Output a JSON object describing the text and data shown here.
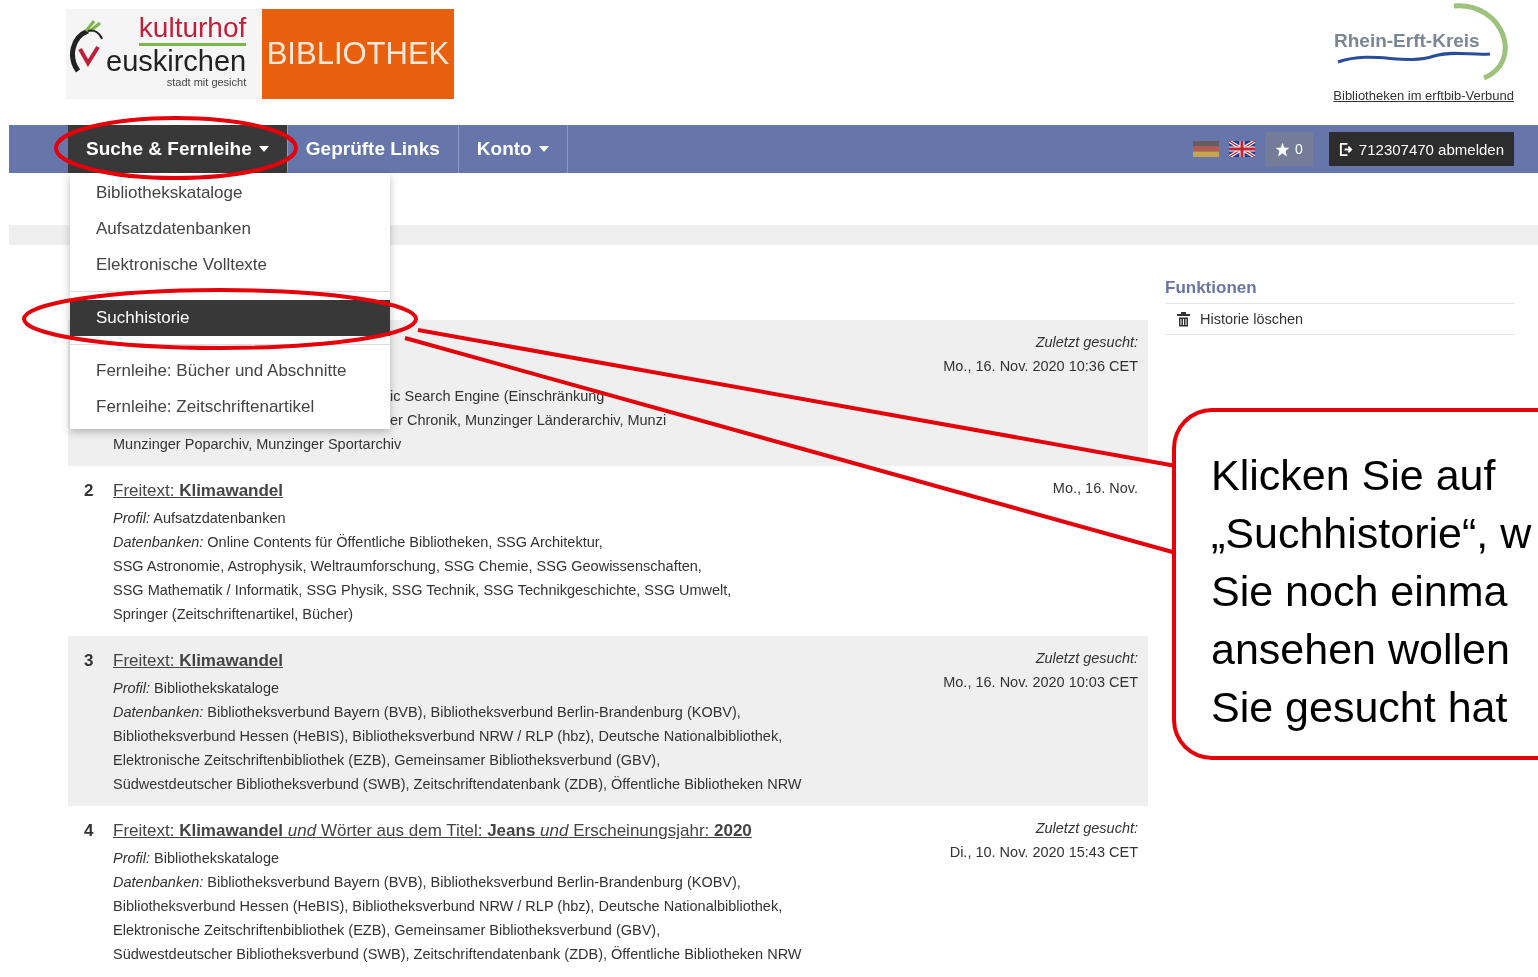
{
  "header": {
    "logo": {
      "line_1": "kulturhof",
      "line_2": "euskirchen",
      "tagline": "stadt mit gesicht",
      "badge": "BIBLIOTHEK"
    },
    "partner": {
      "name": "Rhein-Erft-Kreis",
      "link": "Bibliotheken im erftbib-Verbund"
    }
  },
  "nav": {
    "tabs": [
      {
        "label": "Suche & Fernleihe",
        "dropdown": true,
        "selected": true
      },
      {
        "label": "Geprüfte Links",
        "dropdown": false,
        "selected": false
      },
      {
        "label": "Konto",
        "dropdown": true,
        "selected": false
      }
    ],
    "favorites": {
      "count": "0"
    },
    "logout": {
      "label": "712307470 abmelden"
    }
  },
  "dropdown": {
    "groups": [
      [
        {
          "label": "Bibliothekskataloge",
          "selected": false
        },
        {
          "label": "Aufsatzdatenbanken",
          "selected": false
        },
        {
          "label": "Elektronische Volltexte",
          "selected": false
        }
      ],
      [
        {
          "label": "Suchhistorie",
          "selected": true
        }
      ],
      [
        {
          "label": "Fernleihe: Bücher und Abschnitte",
          "selected": false
        },
        {
          "label": "Fernleihe: Zeitschriftenartikel",
          "selected": false
        }
      ]
    ]
  },
  "history": [
    {
      "kind": "partial",
      "last_label": "Zuletzt gesucht:",
      "date": "Mo., 16. Nov. 2020 10:36 CET",
      "lines": [
        {
          "text": "ic Search Engine (Einschränkung",
          "covered": true
        },
        {
          "text": "er Chronik, Munzinger Länderarchiv, Munzi",
          "covered": true
        },
        {
          "text": "Munzinger Poparchiv, Munzinger Sportarchiv",
          "covered": false
        }
      ]
    },
    {
      "kind": "full",
      "number": "2",
      "query": "Freitext: **Klimawandel**",
      "profile": "*Profil:* Aufsatzdatenbanken",
      "databases": [
        "*Datenbanken:* Online Contents für Öffentliche Bibliotheken, SSG Architektur,",
        "SSG Astronomie, Astrophysik, Weltraumforschung, SSG Chemie, SSG Geowissenschaften,",
        "SSG Mathematik / Informatik, SSG Physik, SSG Technik, SSG Technikgeschichte, SSG Umwelt,",
        "Springer (Zeitschriftenartikel, Bücher)"
      ],
      "date": "Mo., 16. Nov."
    },
    {
      "kind": "full",
      "number": "3",
      "query": "Freitext: **Klimawandel**",
      "profile": "*Profil:* Bibliothekskataloge",
      "databases": [
        "*Datenbanken:* Bibliotheksverbund Bayern (BVB), Bibliotheksverbund Berlin-Brandenburg (KOBV),",
        "Bibliotheksverbund Hessen (HeBIS), Bibliotheksverbund NRW / RLP (hbz), Deutsche Nationalbibliothek,",
        "Elektronische Zeitschriftenbibliothek (EZB), Gemeinsamer Bibliotheksverbund (GBV),",
        "Südwestdeutscher Bibliotheksverbund (SWB), Zeitschriftendatenbank (ZDB), Öffentliche Bibliotheken NRW"
      ],
      "last_label": "Zuletzt gesucht:",
      "date": "Mo., 16. Nov. 2020 10:03 CET"
    },
    {
      "kind": "full",
      "number": "4",
      "query": "Freitext: **Klimawandel** *und* Wörter aus dem Titel: **Jeans** *und* Erscheinungsjahr: **2020**",
      "profile": "*Profil:* Bibliothekskataloge",
      "databases": [
        "*Datenbanken:* Bibliotheksverbund Bayern (BVB), Bibliotheksverbund Berlin-Brandenburg (KOBV),",
        "Bibliotheksverbund Hessen (HeBIS), Bibliotheksverbund NRW / RLP (hbz), Deutsche Nationalbibliothek,",
        "Elektronische Zeitschriftenbibliothek (EZB), Gemeinsamer Bibliotheksverbund (GBV),",
        "Südwestdeutscher Bibliotheksverbund (SWB), Zeitschriftendatenbank (ZDB), Öffentliche Bibliotheken NRW"
      ],
      "last_label": "Zuletzt gesucht:",
      "date": "Di., 10. Nov. 2020 15:43 CET"
    }
  ],
  "sidebar": {
    "title": "Funktionen",
    "actions": [
      {
        "label": "Historie löschen"
      }
    ]
  },
  "callout": {
    "lines": [
      "Klicken Sie auf",
      "„Suchhistorie“, w",
      "Sie noch einma",
      "ansehen wollen",
      "Sie gesucht hat"
    ]
  }
}
